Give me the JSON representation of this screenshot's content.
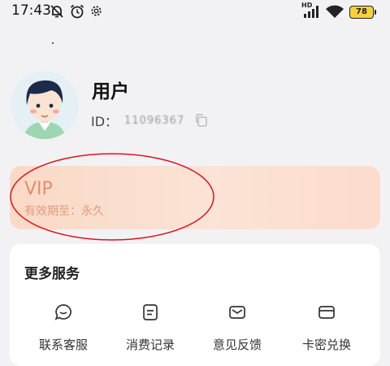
{
  "status_bar": {
    "time": "17:43",
    "network": "HD",
    "battery": "78",
    "icons": [
      "muted-bell-icon",
      "alarm-icon",
      "gear-icon",
      "signal-icon",
      "wifi-icon",
      "battery-icon"
    ]
  },
  "profile": {
    "name": "用户",
    "id_label": "ID：",
    "id_value": "11096367",
    "avatar": "avatar-cartoon-person",
    "copy_icon": "copy-icon"
  },
  "vip": {
    "title": "VIP",
    "validity": "有效期至：永久",
    "highlight_color": "#e0141a"
  },
  "services": {
    "title": "更多服务",
    "items": [
      {
        "label": "联系客服",
        "icon": "chat-bubble-icon"
      },
      {
        "label": "消费记录",
        "icon": "receipt-icon"
      },
      {
        "label": "意见反馈",
        "icon": "mail-icon"
      },
      {
        "label": "卡密兑换",
        "icon": "card-icon"
      }
    ]
  },
  "colors": {
    "accent": "#e38d6b",
    "background": "#f2f2f4",
    "battery": "#f6d23a"
  }
}
